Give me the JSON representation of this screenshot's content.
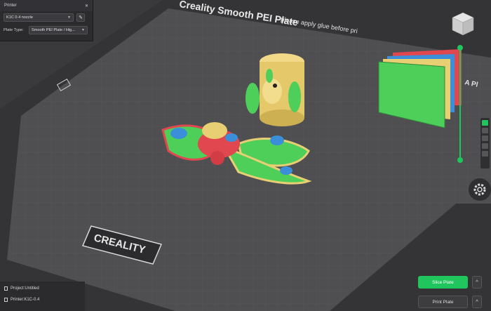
{
  "printer_panel": {
    "title": "Printer",
    "printer_value": "K1C 0.4 nozzle",
    "plate_type_label": "Plate Type:",
    "plate_type_value": "Smooth PEI Plate / Hig..."
  },
  "plate": {
    "title": "Creality Smooth PEI Plate",
    "glue_notice": "please apply glue before pri",
    "side_label": "A Pl",
    "brand": "CREALITY"
  },
  "status": {
    "project": "Project:Untitled",
    "printer": "Printer:K1C-0.4"
  },
  "buttons": {
    "slice": "Slice Plate",
    "print": "Print Plate",
    "up_arrow": "^"
  },
  "colors": {
    "accent": "#21c55d",
    "bed": "#4f4f51",
    "model_green": "#4ecf5a",
    "model_yellow": "#e9cf74",
    "model_red": "#e0474f",
    "model_blue": "#3a8fd8"
  }
}
